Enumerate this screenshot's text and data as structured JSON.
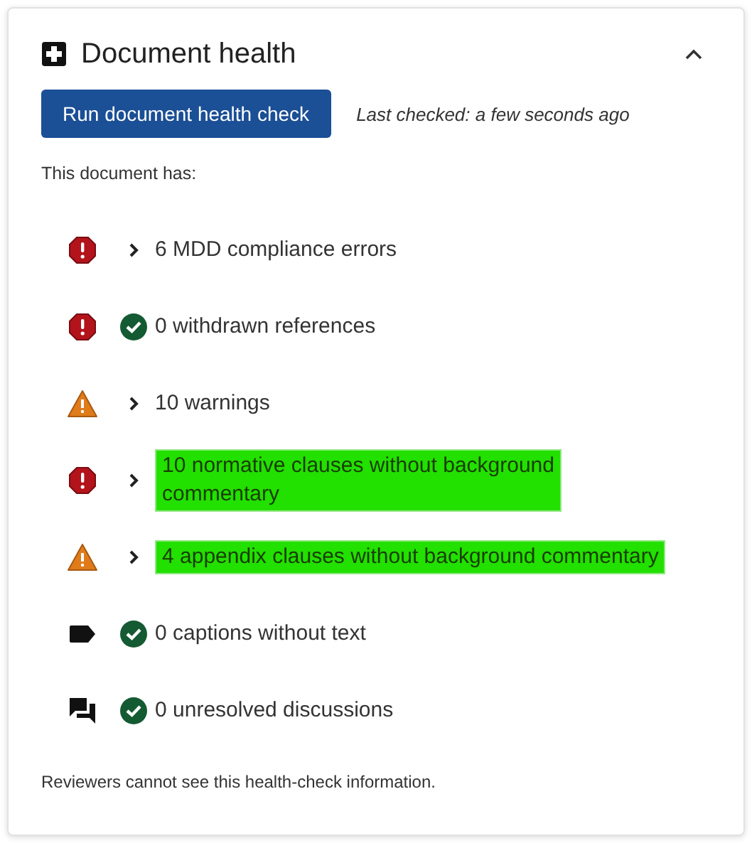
{
  "panel": {
    "title": "Document health",
    "expanded": true
  },
  "run_button": "Run document health check",
  "last_checked": "Last checked: a few seconds ago",
  "intro": "This document has:",
  "items": [
    {
      "kind": "error",
      "passed": false,
      "text": "6 MDD compliance errors",
      "highlighted": false
    },
    {
      "kind": "error",
      "passed": true,
      "text": "0 withdrawn references",
      "highlighted": false
    },
    {
      "kind": "warning",
      "passed": false,
      "text": "10 warnings",
      "highlighted": false
    },
    {
      "kind": "error",
      "passed": false,
      "text": "10 normative clauses without background\ncommentary",
      "highlighted": true
    },
    {
      "kind": "warning",
      "passed": false,
      "text": "4 appendix clauses without background commentary",
      "highlighted": true
    },
    {
      "kind": "caption",
      "passed": true,
      "text": "0 captions without text",
      "highlighted": false
    },
    {
      "kind": "discussion",
      "passed": true,
      "text": "0 unresolved discussions",
      "highlighted": false
    }
  ],
  "footer": "Reviewers cannot see this health-check information."
}
